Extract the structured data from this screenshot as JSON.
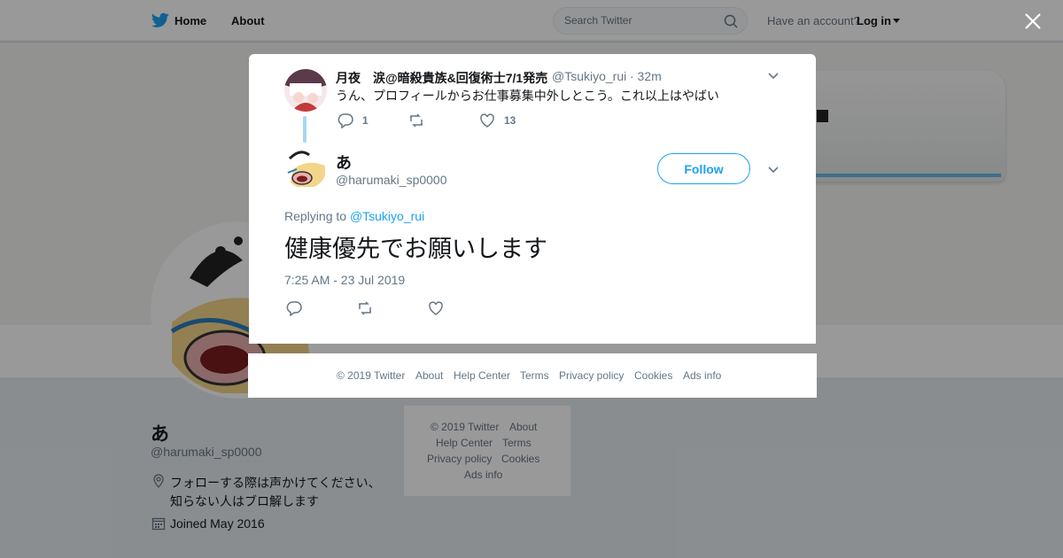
{
  "colors": {
    "brand": "#1da1f2",
    "text": "#14171a",
    "muted": "#657786",
    "border": "#e6ecf0"
  },
  "header": {
    "nav": {
      "home": "Home",
      "about": "About"
    },
    "search_placeholder": "Search Twitter",
    "have_account": "Have an account?",
    "login": "Log in"
  },
  "profile": {
    "name": "あ",
    "handle": "@harumaki_sp0000",
    "bio_line1": "フォローする際は声かけてください、",
    "bio_line2": "知らない人はブロ解します",
    "joined": "Joined May 2016"
  },
  "side_footer": {
    "copyright": "© 2019 Twitter",
    "about": "About",
    "help": "Help Center",
    "terms": "Terms",
    "privacy": "Privacy policy",
    "cookies": "Cookies",
    "ads": "Ads info"
  },
  "parent_tweet": {
    "name": "月夜　涙@暗殺貴族&回復術士7/1発売",
    "handle": "@Tsukiyo_rui",
    "time": "· 32m",
    "text": "うん、プロフィールからお仕事募集中外しとこう。これ以上はやばい",
    "replies": "1",
    "likes": "13"
  },
  "main_tweet": {
    "name": "あ",
    "handle": "@harumaki_sp0000",
    "follow_label": "Follow",
    "replying_prefix": "Replying to",
    "replying_to": "@Tsukiyo_rui",
    "text": "健康優先でお願いします",
    "datetime": "7:25 AM - 23 Jul 2019"
  },
  "modal_footer": {
    "copyright": "© 2019 Twitter",
    "about": "About",
    "help": "Help Center",
    "terms": "Terms",
    "privacy": "Privacy policy",
    "cookies": "Cookies",
    "ads": "Ads info"
  },
  "icons": [
    "twitter-bird-icon",
    "search-icon",
    "caret-down-icon",
    "close-icon",
    "chevron-down-icon",
    "reply-icon",
    "retweet-icon",
    "like-icon",
    "location-icon",
    "calendar-icon"
  ]
}
